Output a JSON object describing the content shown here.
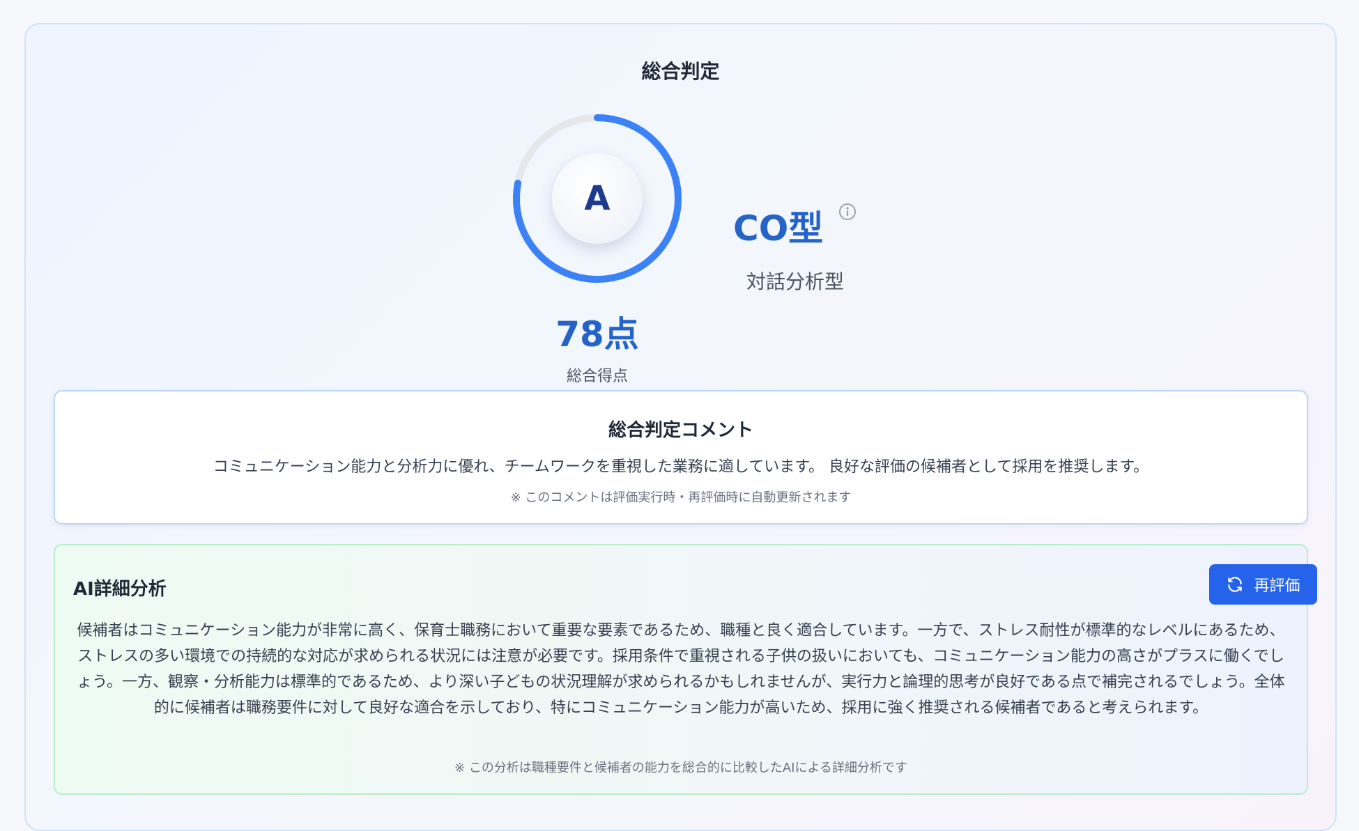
{
  "overall": {
    "title": "総合判定",
    "grade": "A",
    "score": 78,
    "score_text": "78点",
    "score_label": "総合得点",
    "type_code": "CO型",
    "type_name": "対話分析型",
    "info_icon": "info-circle-icon",
    "accent_color": "#3b82f6",
    "track_color": "#e5e7eb"
  },
  "comment": {
    "title": "総合判定コメント",
    "text": "コミュニケーション能力と分析力に優れ、チームワークを重視した業務に適しています。 良好な評価の候補者として採用を推奨します。",
    "note": "※ このコメントは評価実行時・再評価時に自動更新されます"
  },
  "ai_analysis": {
    "title": "AI詳細分析",
    "reevaluate_label": "再評価",
    "reevaluate_icon": "refresh-icon",
    "button_color": "#2563eb",
    "text": "候補者はコミュニケーション能力が非常に高く、保育士職務において重要な要素であるため、職種と良く適合しています。一方で、ストレス耐性が標準的なレベルにあるため、ストレスの多い環境での持続的な対応が求められる状況には注意が必要です。採用条件で重視される子供の扱いにおいても、コミュニケーション能力の高さがプラスに働くでしょう。一方、観察・分析能力は標準的であるため、より深い子どもの状況理解が求められるかもしれませんが、実行力と論理的思考が良好である点で補完されるでしょう。全体的に候補者は職務要件に対して良好な適合を示しており、特にコミュニケーション能力が高いため、採用に強く推奨される候補者であると考えられます。",
    "note": "※ この分析は職種要件と候補者の能力を総合的に比較したAIによる詳細分析です"
  }
}
